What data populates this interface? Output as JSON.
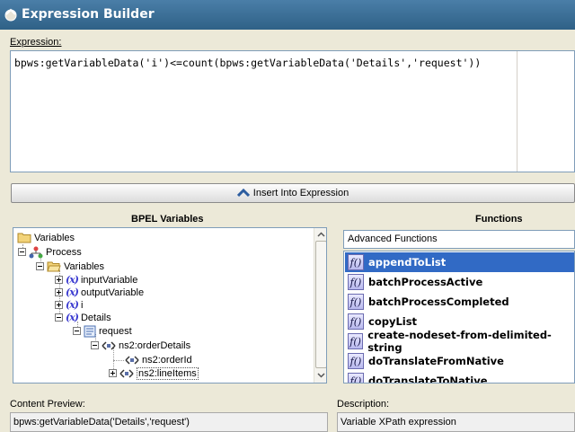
{
  "window": {
    "title": "Expression Builder"
  },
  "expression": {
    "label": "Expression:",
    "value": "bpws:getVariableData('i')<=count(bpws:getVariableData('Details','request'))"
  },
  "insert_button": {
    "label": "Insert Into Expression"
  },
  "variables_panel": {
    "title": "BPEL Variables",
    "tree": {
      "root": "Variables",
      "process": "Process",
      "variables": "Variables",
      "inputVariable": "inputVariable",
      "outputVariable": "outputVariable",
      "i": "i",
      "details": "Details",
      "request": "request",
      "orderDetails": "ns2:orderDetails",
      "orderId": "ns2:orderId",
      "lineItems": "ns2:lineItems"
    }
  },
  "functions_panel": {
    "title": "Functions",
    "category": "Advanced Functions",
    "items": [
      "appendToList",
      "batchProcessActive",
      "batchProcessCompleted",
      "copyList",
      "create-nodeset-from-delimited-string",
      "doTranslateFromNative",
      "doTranslateToNative"
    ]
  },
  "content_preview": {
    "label": "Content Preview:",
    "value": "bpws:getVariableData('Details','request')"
  },
  "description": {
    "label": "Description:",
    "value": "Variable XPath expression"
  },
  "colors": {
    "selection": "#316ac5",
    "titlebar": "#3a6d95"
  }
}
